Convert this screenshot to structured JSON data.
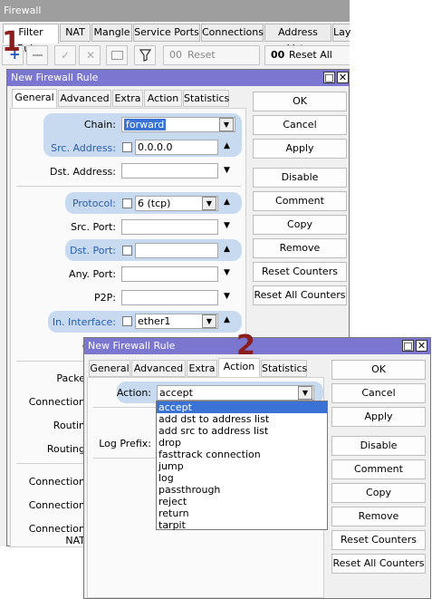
{
  "firewall": {
    "title": "Firewall",
    "tabs": [
      "Filter Rules",
      "NAT",
      "Mangle",
      "Service Ports",
      "Connections",
      "Address Lists",
      "Lay"
    ],
    "toolbar": {
      "reset_counters": "Reset Counters",
      "reset_all_counters": "Reset All Coun",
      "counter_glyph": "00"
    },
    "marker": "1"
  },
  "rule_dialog": {
    "title": "New Firewall Rule",
    "tabs": [
      "General",
      "Advanced",
      "Extra",
      "Action",
      "Statistics"
    ],
    "fields": {
      "chain": {
        "label": "Chain:",
        "value": "forward"
      },
      "src_address": {
        "label": "Src. Address:",
        "value": "0.0.0.0"
      },
      "dst_address": {
        "label": "Dst. Address:",
        "value": ""
      },
      "protocol": {
        "label": "Protocol:",
        "value": "6 (tcp)"
      },
      "src_port": {
        "label": "Src. Port:",
        "value": ""
      },
      "dst_port": {
        "label": "Dst. Port:",
        "value": ""
      },
      "any_port": {
        "label": "Any. Port:",
        "value": ""
      },
      "p2p": {
        "label": "P2P:",
        "value": ""
      },
      "in_interface": {
        "label": "In. Interface:",
        "value": "ether1"
      },
      "out_interface": {
        "label": "Out. In"
      }
    },
    "hidden_labels": [
      "Packe",
      "Connection",
      "Routin",
      "Routing",
      "Connection",
      "Connection",
      "Connection NAT"
    ],
    "buttons": [
      "OK",
      "Cancel",
      "Apply",
      "Disable",
      "Comment",
      "Copy",
      "Remove",
      "Reset Counters",
      "Reset All Counters"
    ]
  },
  "action_dialog": {
    "title": "New Firewall Rule",
    "marker": "2",
    "tabs": [
      "General",
      "Advanced",
      "Extra",
      "Action",
      "Statistics"
    ],
    "action_label": "Action:",
    "action_value": "accept",
    "log_prefix_label": "Log Prefix:",
    "options": [
      "accept",
      "add dst to address list",
      "add src to address list",
      "drop",
      "fasttrack connection",
      "jump",
      "log",
      "passthrough",
      "reject",
      "return",
      "tarpit"
    ],
    "buttons": [
      "OK",
      "Cancel",
      "Apply",
      "Disable",
      "Comment",
      "Copy",
      "Remove",
      "Reset Counters",
      "Reset All Counters"
    ]
  },
  "colors": {
    "title_bar": "#7b76cf",
    "highlight": "#c8daf0",
    "selected": "#3a72d6",
    "marker": "#8a1e1e"
  }
}
